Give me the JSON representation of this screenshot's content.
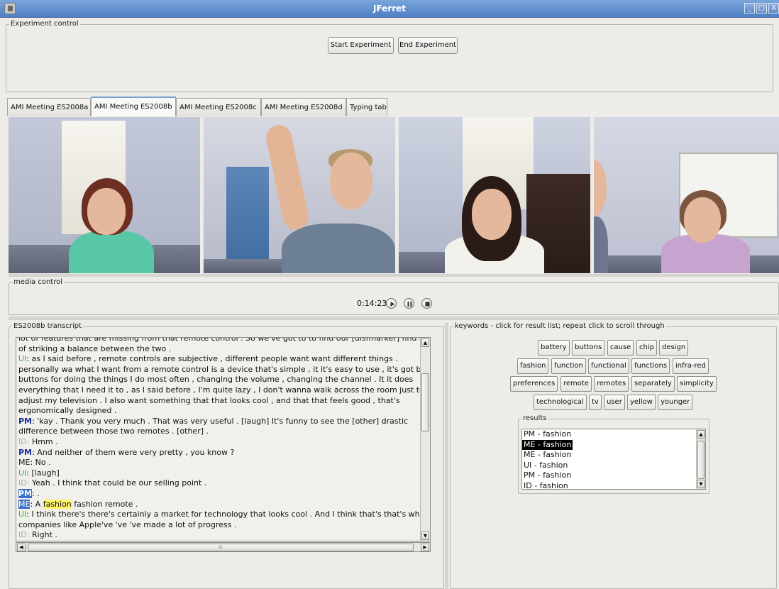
{
  "window": {
    "title": "JFerret",
    "minimize": "_",
    "maximize": "□",
    "close": "X"
  },
  "experiment_control": {
    "legend": "Experiment control",
    "start_label": "Start Experiment",
    "end_label": "End Experiment"
  },
  "tabs": [
    {
      "label": "AMI Meeting ES2008a",
      "active": false
    },
    {
      "label": "AMI Meeting ES2008b",
      "active": true
    },
    {
      "label": "AMI Meeting ES2008c",
      "active": false
    },
    {
      "label": "AMI Meeting ES2008d",
      "active": false
    },
    {
      "label": "Typing tab",
      "active": false
    }
  ],
  "media_control": {
    "legend": "media control",
    "time": "0:14:23",
    "icons": [
      "play-icon",
      "pause-icon",
      "stop-icon"
    ]
  },
  "transcript": {
    "legend": "ES2008b transcript",
    "lines": [
      {
        "speaker": "",
        "text": "lot of features that are missing from that remote control . So we've got to to find our [disfmarker] find a"
      },
      {
        "speaker": "",
        "text": "of striking a balance between the two ."
      },
      {
        "speaker": "UI",
        "text": "as I said before , remote controls are subjective , different people want want different things ."
      },
      {
        "speaker": "",
        "text": "personally wa what I want from a remote control is a device that's simple , it it's easy to use ,  it's got big"
      },
      {
        "speaker": "",
        "text": "buttons for doing the things I do most often , changing the volume , changing the channel . It it does"
      },
      {
        "speaker": "",
        "text": "everything that I need it to  , as I said before , I'm quite lazy , I don't wanna walk across the room just to"
      },
      {
        "speaker": "",
        "text": "adjust my television . I also want something that that looks cool ,  and that that feels good , that's"
      },
      {
        "speaker": "",
        "text": "ergonomically designed ."
      },
      {
        "speaker": "PM",
        "text": "'kay . Thank you very much . That was very useful . [laugh] It's funny to see the [other] drastic"
      },
      {
        "speaker": "",
        "text": "difference between those two remotes . [other]  ."
      },
      {
        "speaker": "ID",
        "text": "Hmm ."
      },
      {
        "speaker": "PM",
        "text": "And neither of them were very pretty , you know ?"
      },
      {
        "speaker": "ME",
        "text": "No ."
      },
      {
        "speaker": "UI",
        "text": "[laugh]"
      },
      {
        "speaker": "ID",
        "text": "Yeah . I think that could be our selling point ."
      },
      {
        "speaker": "PM",
        "text": " .",
        "highlight": true
      },
      {
        "speaker": "ME",
        "text_before": "A ",
        "keyword": "fashion",
        "text_after": " fashion remote .",
        "highlight": true
      },
      {
        "speaker": "UI",
        "text": "I think there's there's certainly a market for technology that looks cool . And I think that's that's why"
      },
      {
        "speaker": "",
        "text": "companies like Apple've 've 've made a lot of progress ."
      },
      {
        "speaker": "ID",
        "text": "Right ."
      }
    ],
    "hscroll_grip": "III"
  },
  "keywords": {
    "legend": "keywords - click for result list; repeat click to scroll through",
    "rows": [
      [
        "battery",
        "buttons",
        "cause",
        "chip",
        "design"
      ],
      [
        "fashion",
        "function",
        "functional",
        "functions",
        "infra-red"
      ],
      [
        "preferences",
        "remote",
        "remotes",
        "separately",
        "simplicity"
      ],
      [
        "technological",
        "tv",
        "user",
        "yellow",
        "younger"
      ]
    ]
  },
  "results": {
    "legend": "results",
    "items": [
      "PM - fashion",
      "ME - fashion",
      "ME - fashion",
      "UI - fashion",
      "PM - fashion",
      "ID - fashion"
    ],
    "selected_index": 1
  },
  "colors": {
    "speaker_UI": "#3bb036",
    "speaker_PM": "#1a2f9c",
    "speaker_ID": "#aaaaaa",
    "keyword_highlight": "#fff36a",
    "speaker_highlight": "#3d6ec8",
    "titlebar": "#5f8ed0"
  }
}
